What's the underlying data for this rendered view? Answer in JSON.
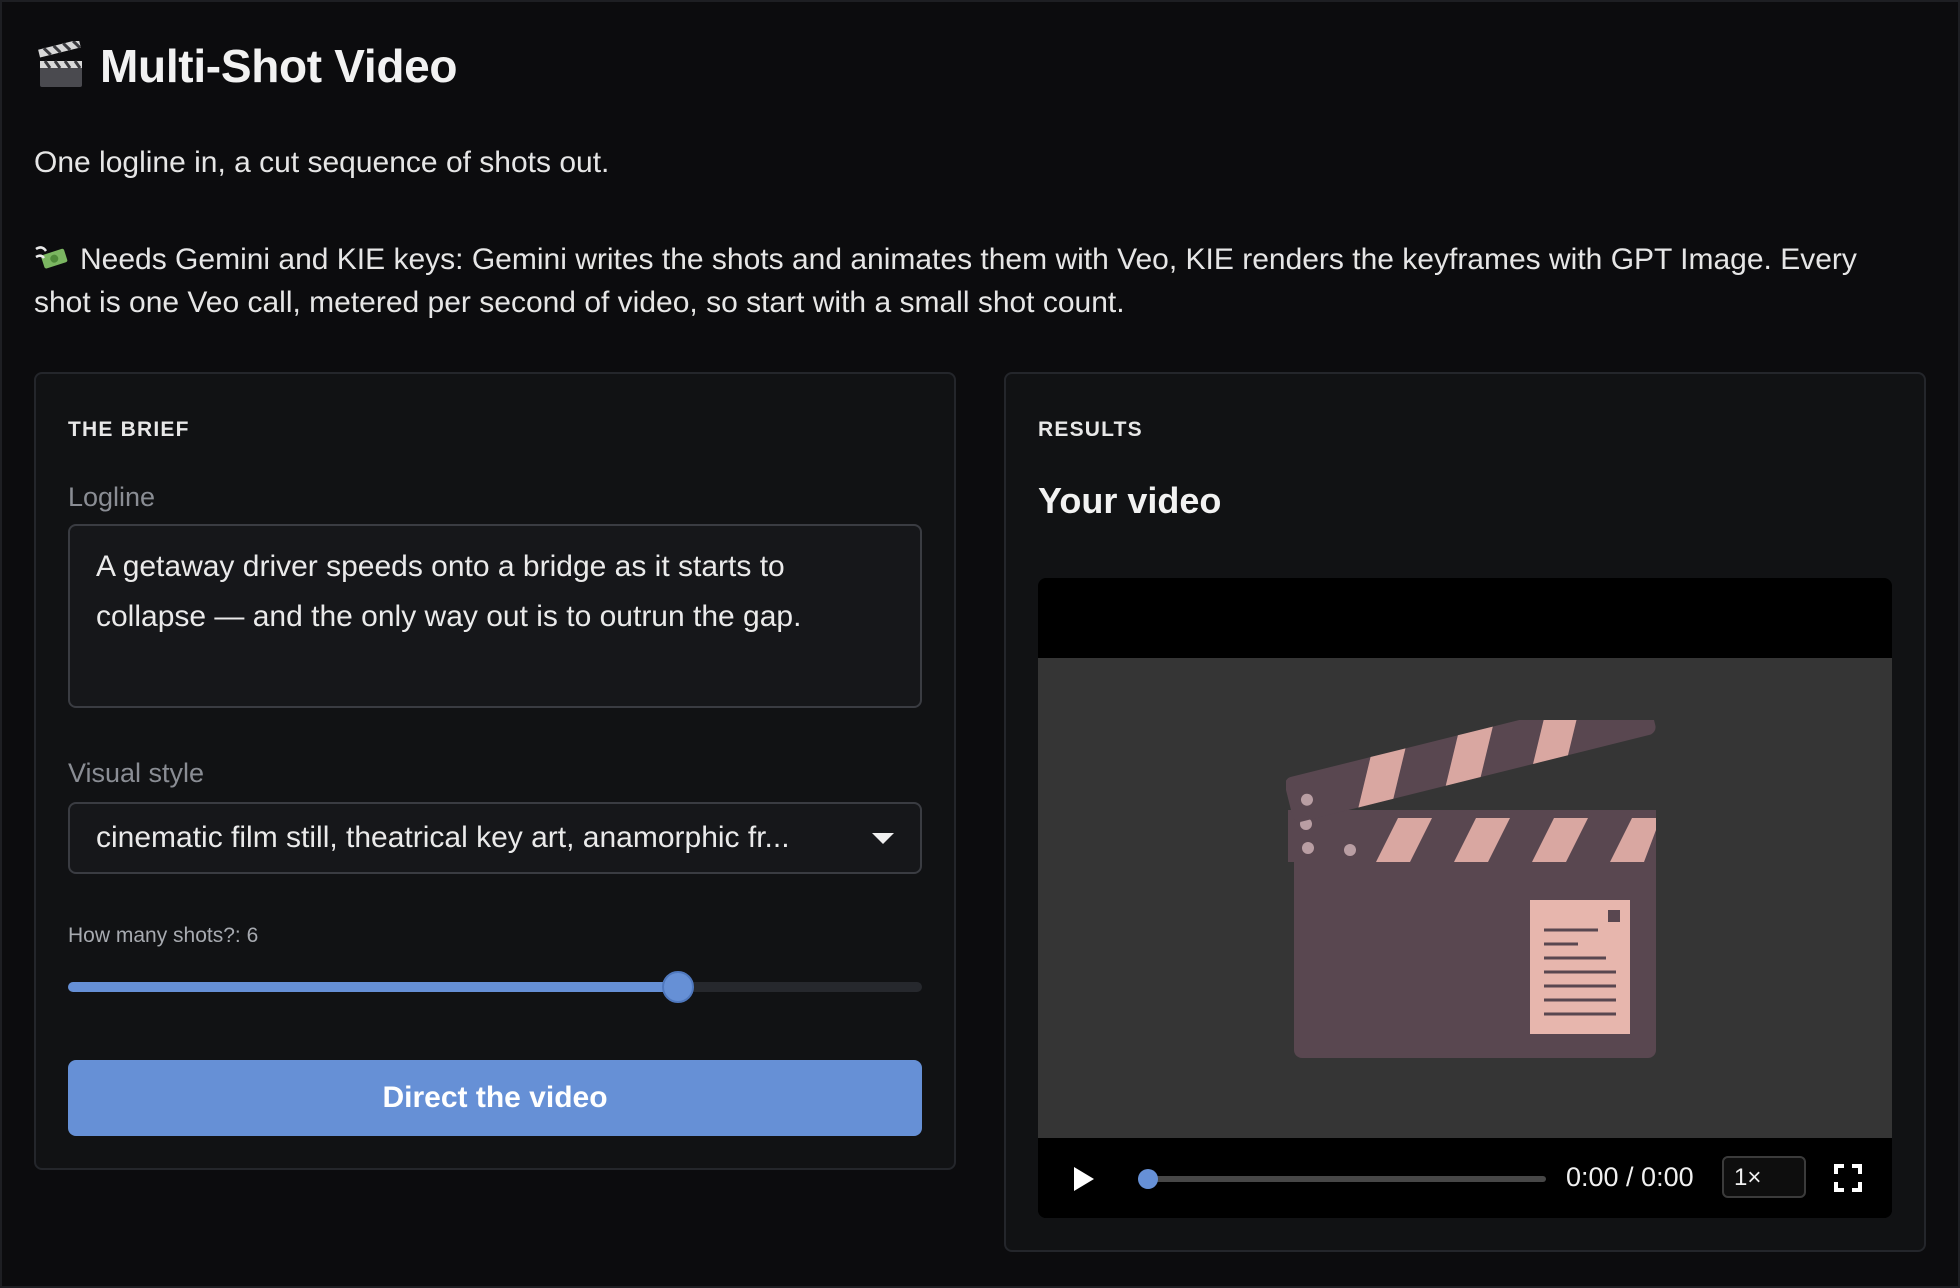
{
  "header": {
    "title_icon": "clapper-board-icon",
    "title": "Multi-Shot Video",
    "subtitle": "One logline in, a cut sequence of shots out.",
    "note_icon": "money-with-wings-icon",
    "note": "Needs Gemini and KIE keys: Gemini writes the shots and animates them with Veo, KIE renders the keyframes with GPT Image. Every shot is one Veo call, metered per second of video, so start with a small shot count."
  },
  "brief": {
    "section_label": "THE BRIEF",
    "logline_label": "Logline",
    "logline_value": "A getaway driver speeds onto a bridge as it starts to collapse — and the only way out is to outrun the gap.",
    "style_label": "Visual style",
    "style_value": "cinematic film still, theatrical key art, anamorphic fr...",
    "shots_label": "How many shots?: 6",
    "shots_fraction": 0.714,
    "submit_label": "Direct the video"
  },
  "results": {
    "section_label": "RESULTS",
    "heading": "Your video",
    "poster_icon": "clapperboard-poster-icon",
    "time": "0:00 / 0:00",
    "speed": "1×",
    "progress_fraction": 0
  },
  "colors": {
    "accent": "#6690d6",
    "background": "#0c0c0e",
    "panel": "#111214",
    "poster_board": "#594750",
    "poster_stripe": "#d9a7a1"
  }
}
